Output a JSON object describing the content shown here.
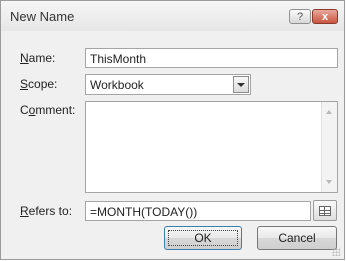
{
  "dialog": {
    "title": "New Name",
    "help_button": "?",
    "close_button": "x"
  },
  "labels": {
    "name_first": "N",
    "name_rest": "ame:",
    "scope_first": "S",
    "scope_rest": "cope:",
    "comment_pre": "C",
    "comment_u": "o",
    "comment_rest": "mment:",
    "refers_first": "R",
    "refers_rest": "efers to:"
  },
  "fields": {
    "name_value": "ThisMonth",
    "scope_value": "Workbook",
    "comment_value": "",
    "refers_value": "=MONTH(TODAY())"
  },
  "buttons": {
    "ok": "OK",
    "cancel": "Cancel"
  }
}
